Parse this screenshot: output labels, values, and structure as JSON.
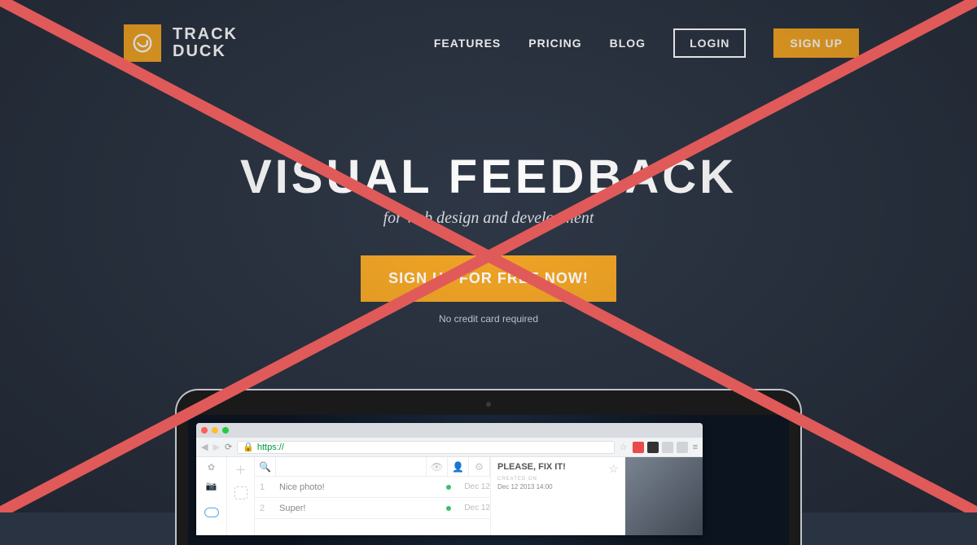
{
  "brand": {
    "line1": "TRACK",
    "line2": "DUCK"
  },
  "nav": {
    "items": [
      "FEATURES",
      "PRICING",
      "BLOG"
    ],
    "login": "LOGIN",
    "signup": "SIGN UP"
  },
  "hero": {
    "headline": "VISUAL FEEDBACK",
    "subline": "for web design and development",
    "cta": "SIGN UP FOR FREE NOW!",
    "note": "No credit card required"
  },
  "browser": {
    "url_prefix": "https://"
  },
  "app": {
    "rows": [
      {
        "n": "1",
        "text": "Nice photo!",
        "date": "Dec 12"
      },
      {
        "n": "2",
        "text": "Super!",
        "date": "Dec 12"
      }
    ],
    "detail": {
      "title": "PLEASE, FIX IT!",
      "created_label": "CREATED ON",
      "created_value": "Dec 12 2013 14:00"
    }
  },
  "colors": {
    "accent": "#f5a623",
    "cross": "#e05a5a"
  }
}
